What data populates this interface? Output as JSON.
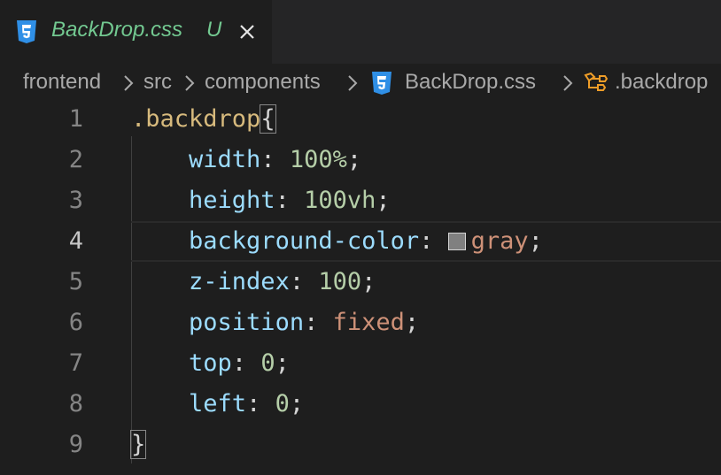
{
  "tab": {
    "title": "BackDrop.css",
    "status": "U",
    "icon": "css3-file-icon",
    "status_color": "#73c991"
  },
  "breadcrumb": {
    "items": [
      "frontend",
      "src",
      "components",
      "BackDrop.css",
      ".backdrop"
    ],
    "separator_icon": "chevron-right-icon",
    "symbol_icon": "symbol-class-icon"
  },
  "editor": {
    "active_line": 4,
    "line_numbers": [
      "1",
      "2",
      "3",
      "4",
      "5",
      "6",
      "7",
      "8",
      "9"
    ],
    "lines": [
      {
        "selector": ".backdrop",
        "open": "{"
      },
      {
        "prop": "width",
        "value": "100%"
      },
      {
        "prop": "height",
        "value": "100vh"
      },
      {
        "prop": "background-color",
        "value": "gray",
        "swatch": "#808080"
      },
      {
        "prop": "z-index",
        "value": "100"
      },
      {
        "prop": "position",
        "value": "fixed"
      },
      {
        "prop": "top",
        "value": "0"
      },
      {
        "prop": "left",
        "value": "0"
      },
      {
        "close": "}"
      }
    ]
  },
  "colors": {
    "background": "#1e1e1e",
    "tabbar": "#252526",
    "selector": "#d7ba7d",
    "property": "#9cdcfe",
    "number": "#b5cea8",
    "keyword_value": "#ce9178",
    "css_icon": "#2f8fe6",
    "symbol_icon": "#ee9d28"
  }
}
